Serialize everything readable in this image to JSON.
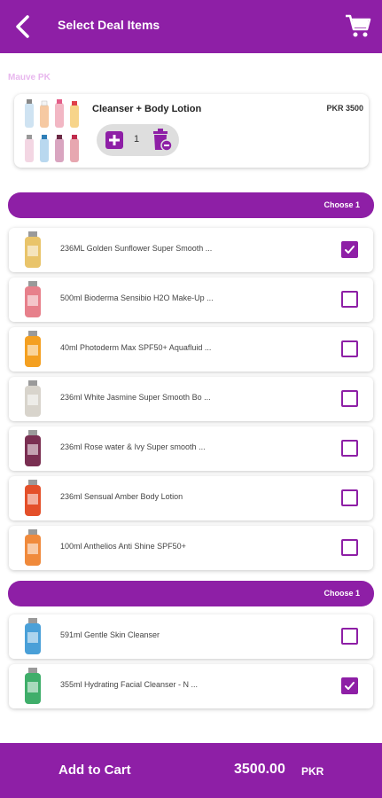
{
  "header": {
    "title": "Select Deal Items"
  },
  "vendor": "Mauve PK",
  "deal": {
    "name": "Cleanser + Body Lotion",
    "price": "PKR 3500",
    "quantity": "1"
  },
  "groups": [
    {
      "label": "Choose 1",
      "items": [
        {
          "name": "236ML Golden Sunflower Super Smooth ...",
          "checked": true,
          "color": "#e9c46a"
        },
        {
          "name": "500ml Bioderma Sensibio H2O Make-Up ...",
          "checked": false,
          "color": "#e7808b"
        },
        {
          "name": "40ml Photoderm Max SPF50+ Aquafluid ...",
          "checked": false,
          "color": "#f4a021"
        },
        {
          "name": "236ml White Jasmine Super Smooth Bo ...",
          "checked": false,
          "color": "#d8d4cc"
        },
        {
          "name": "236ml Rose water & Ivy Super smooth ...",
          "checked": false,
          "color": "#7a2f52"
        },
        {
          "name": "236ml Sensual Amber Body Lotion",
          "checked": false,
          "color": "#e4502a"
        },
        {
          "name": "100ml Anthelios Anti Shine SPF50+",
          "checked": false,
          "color": "#f08a3c"
        }
      ]
    },
    {
      "label": "Choose 1",
      "items": [
        {
          "name": "591ml Gentle Skin Cleanser",
          "checked": false,
          "color": "#4aa0d8"
        },
        {
          "name": "355ml Hydrating Facial Cleanser - N ...",
          "checked": true,
          "color": "#3fae6a"
        }
      ]
    }
  ],
  "footer": {
    "add_to_cart": "Add to Cart",
    "total": "3500.00",
    "currency": "PKR"
  },
  "colors": {
    "primary": "#8e1fa6",
    "vendor": "#e8b7ee"
  }
}
